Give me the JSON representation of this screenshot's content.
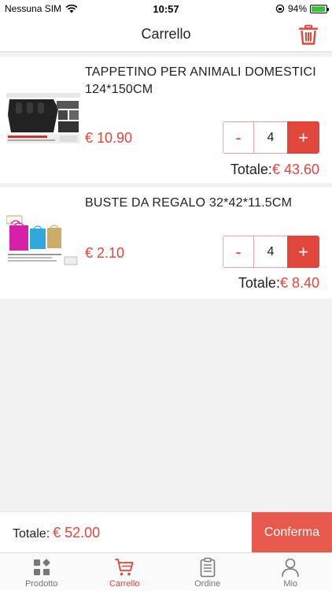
{
  "status_bar": {
    "carrier": "Nessuna SIM",
    "time": "10:57",
    "battery": "94%",
    "battery_level": 0.94
  },
  "header": {
    "title": "Carrello",
    "trash_icon": "trash-icon"
  },
  "items": [
    {
      "name": "TAPPETINO PER ANIMALI DOMESTICI 124*150CM",
      "price": "€ 10.90",
      "quantity": "4",
      "minus": "-",
      "plus": "+",
      "total_label": "Totale:",
      "total_value": "€ 43.60",
      "image_icon": "pet-seat-cover-product-image"
    },
    {
      "name": "BUSTE DA REGALO 32*42*11.5CM",
      "price": "€ 2.10",
      "quantity": "4",
      "minus": "-",
      "plus": "+",
      "total_label": "Totale:",
      "total_value": "€ 8.40",
      "image_icon": "gift-bags-product-image"
    }
  ],
  "footer": {
    "total_label": "Totale:",
    "total_value": "€ 52.00",
    "confirm_label": "Conferma"
  },
  "tabs": [
    {
      "label": "Prodotto",
      "icon": "grid-icon",
      "active": false
    },
    {
      "label": "Carrello",
      "icon": "cart-icon",
      "active": true
    },
    {
      "label": "Ordine",
      "icon": "clipboard-icon",
      "active": false
    },
    {
      "label": "Mio",
      "icon": "person-icon",
      "active": false
    }
  ],
  "colors": {
    "accent": "#e0463c",
    "confirm": "#e65a4e",
    "background": "#f2f2f2"
  }
}
